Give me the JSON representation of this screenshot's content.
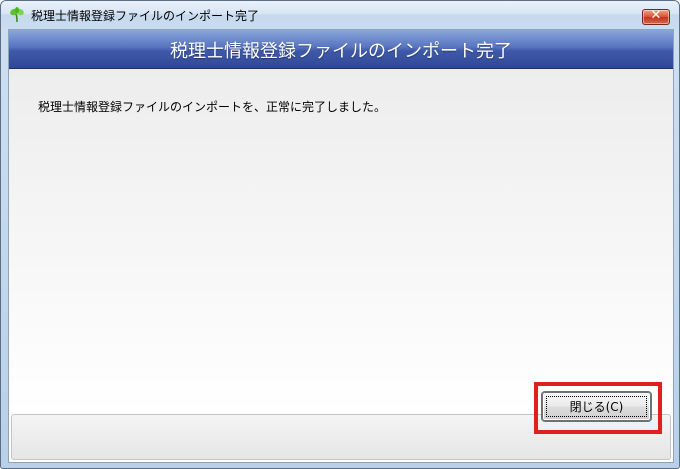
{
  "window": {
    "title": "税理士情報登録ファイルのインポート完了",
    "icon": "app-green-leaf-icon",
    "close_glyph": "✕"
  },
  "banner": {
    "title": "税理士情報登録ファイルのインポート完了"
  },
  "content": {
    "message": "税理士情報登録ファイルのインポートを、正常に完了しました。"
  },
  "footer": {
    "close_button_label": "閉じる(C)",
    "highlight_color": "#e0201f"
  }
}
